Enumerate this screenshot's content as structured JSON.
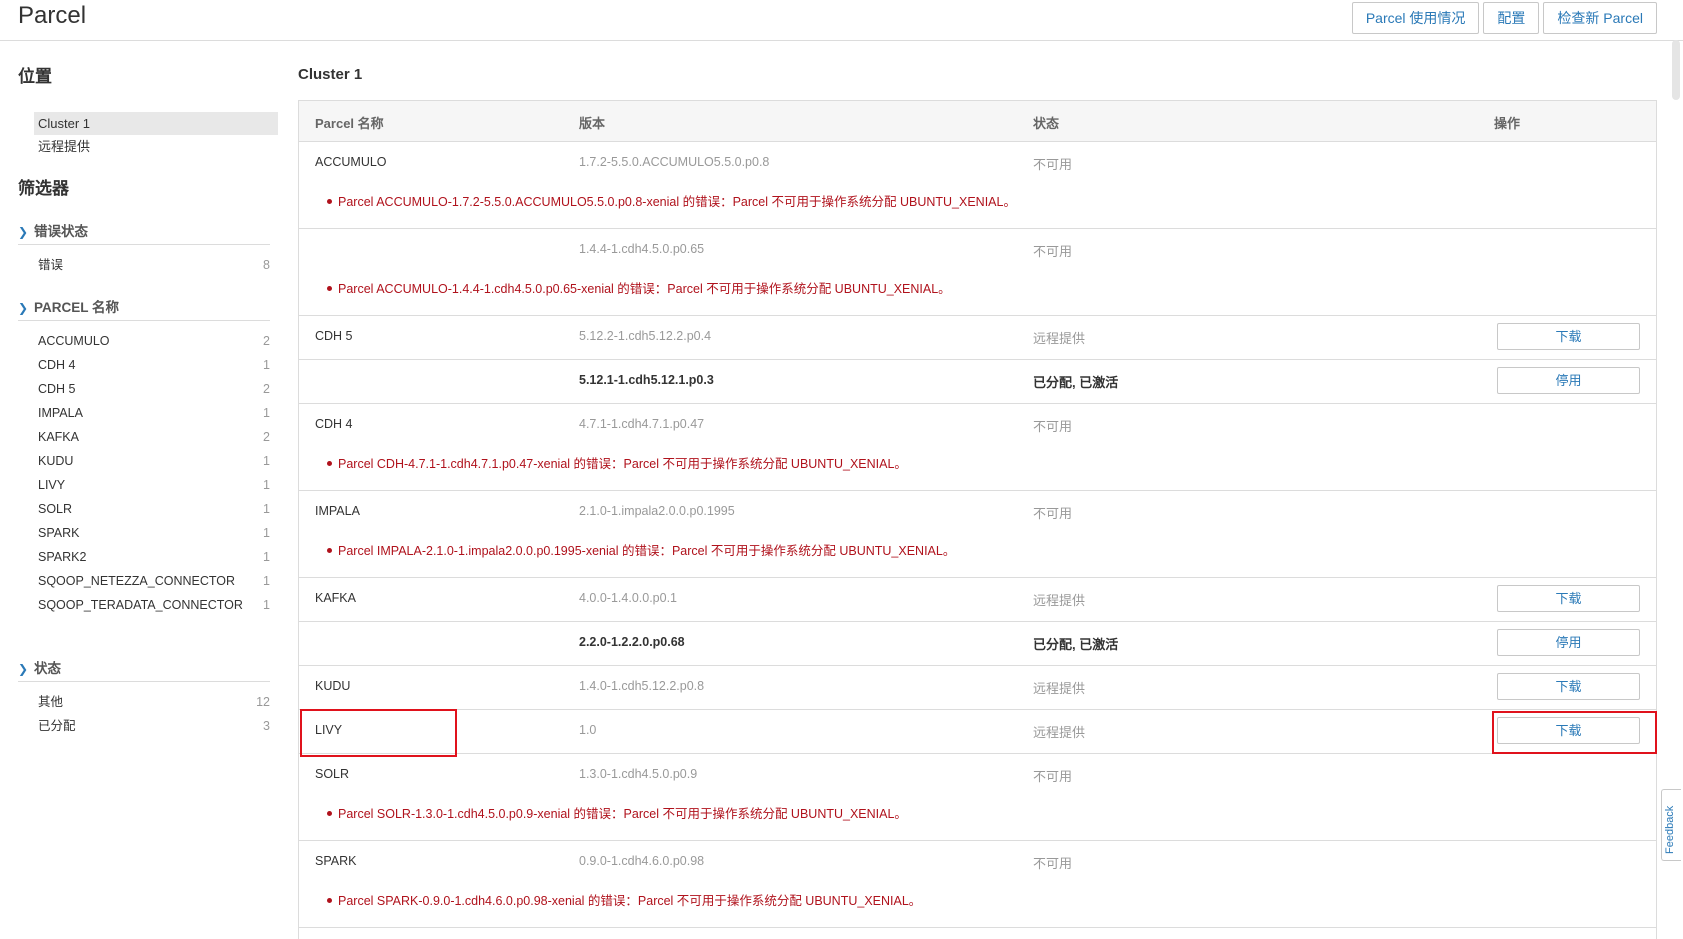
{
  "header": {
    "title": "Parcel",
    "actions": [
      "Parcel 使用情况",
      "配置",
      "检查新 Parcel"
    ]
  },
  "sidebar": {
    "location_title": "位置",
    "locations": [
      "Cluster 1",
      "远程提供"
    ],
    "filters_title": "筛选器",
    "groups": [
      {
        "title": "错误状态",
        "items": [
          {
            "label": "错误",
            "count": "8"
          }
        ]
      },
      {
        "title": "PARCEL 名称",
        "items": [
          {
            "label": "ACCUMULO",
            "count": "2"
          },
          {
            "label": "CDH 4",
            "count": "1"
          },
          {
            "label": "CDH 5",
            "count": "2"
          },
          {
            "label": "IMPALA",
            "count": "1"
          },
          {
            "label": "KAFKA",
            "count": "2"
          },
          {
            "label": "KUDU",
            "count": "1"
          },
          {
            "label": "LIVY",
            "count": "1"
          },
          {
            "label": "SOLR",
            "count": "1"
          },
          {
            "label": "SPARK",
            "count": "1"
          },
          {
            "label": "SPARK2",
            "count": "1"
          },
          {
            "label": "SQOOP_NETEZZA_CONNECTOR",
            "count": "1"
          },
          {
            "label": "SQOOP_TERADATA_CONNECTOR",
            "count": "1"
          }
        ]
      },
      {
        "title": "状态",
        "items": [
          {
            "label": "其他",
            "count": "12"
          },
          {
            "label": "已分配",
            "count": "3"
          }
        ]
      }
    ]
  },
  "main": {
    "cluster_title": "Cluster 1",
    "columns": [
      "Parcel 名称",
      "版本",
      "状态",
      "操作"
    ],
    "rows": [
      {
        "name": "ACCUMULO",
        "version": "1.7.2-5.5.0.ACCUMULO5.5.0.p0.8",
        "status": "不可用",
        "error": "Parcel ACCUMULO-1.7.2-5.5.0.ACCUMULO5.5.0.p0.8-xenial 的错误：Parcel 不可用于操作系统分配 UBUNTU_XENIAL。"
      },
      {
        "name": "",
        "version": "1.4.4-1.cdh4.5.0.p0.65",
        "status": "不可用",
        "error": "Parcel ACCUMULO-1.4.4-1.cdh4.5.0.p0.65-xenial 的错误：Parcel 不可用于操作系统分配 UBUNTU_XENIAL。"
      },
      {
        "name": "CDH 5",
        "version": "5.12.2-1.cdh5.12.2.p0.4",
        "status": "远程提供",
        "action": "下载"
      },
      {
        "name": "",
        "version": "5.12.1-1.cdh5.12.1.p0.3",
        "status": "已分配, 已激活",
        "action": "停用",
        "bold": true
      },
      {
        "name": "CDH 4",
        "version": "4.7.1-1.cdh4.7.1.p0.47",
        "status": "不可用",
        "error": "Parcel CDH-4.7.1-1.cdh4.7.1.p0.47-xenial 的错误：Parcel 不可用于操作系统分配 UBUNTU_XENIAL。"
      },
      {
        "name": "IMPALA",
        "version": "2.1.0-1.impala2.0.0.p0.1995",
        "status": "不可用",
        "error": "Parcel IMPALA-2.1.0-1.impala2.0.0.p0.1995-xenial 的错误：Parcel 不可用于操作系统分配 UBUNTU_XENIAL。"
      },
      {
        "name": "KAFKA",
        "version": "4.0.0-1.4.0.0.p0.1",
        "status": "远程提供",
        "action": "下载"
      },
      {
        "name": "",
        "version": "2.2.0-1.2.2.0.p0.68",
        "status": "已分配, 已激活",
        "action": "停用",
        "bold": true
      },
      {
        "name": "KUDU",
        "version": "1.4.0-1.cdh5.12.2.p0.8",
        "status": "远程提供",
        "action": "下载"
      },
      {
        "name": "LIVY",
        "version": "1.0",
        "status": "远程提供",
        "action": "下载"
      },
      {
        "name": "SOLR",
        "version": "1.3.0-1.cdh4.5.0.p0.9",
        "status": "不可用",
        "error": "Parcel SOLR-1.3.0-1.cdh4.5.0.p0.9-xenial 的错误：Parcel 不可用于操作系统分配 UBUNTU_XENIAL。"
      },
      {
        "name": "SPARK",
        "version": "0.9.0-1.cdh4.6.0.p0.98",
        "status": "不可用",
        "error": "Parcel SPARK-0.9.0-1.cdh4.6.0.p0.98-xenial 的错误：Parcel 不可用于操作系统分配 UBUNTU_XENIAL。"
      }
    ]
  },
  "feedback_label": "Feedback",
  "colors": {
    "accent": "#2a79b7",
    "error": "#b0121c",
    "highlight": "#e0121c"
  }
}
